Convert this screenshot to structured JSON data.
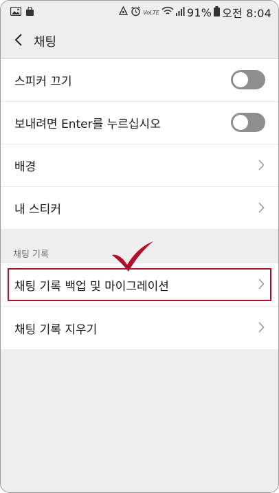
{
  "statusbar": {
    "battery": "91%",
    "time": "오전 8:04",
    "volte": "VoLTE"
  },
  "appbar": {
    "title": "채팅"
  },
  "settings": {
    "mute_sticker": {
      "label": "스피커 끄기",
      "toggle": "off"
    },
    "enter_to_send": {
      "label": "보내려면 Enter를 누르십시오",
      "toggle": "off"
    },
    "background": {
      "label": "배경"
    },
    "my_stickers": {
      "label": "내 스티커"
    }
  },
  "chat_history": {
    "section_label": "채팅 기록",
    "backup": {
      "label": "채팅 기록 백업 및 마이그레이션"
    },
    "clear": {
      "label": "채팅 기록 지우기"
    }
  },
  "colors": {
    "accent_red": "#b10f2e",
    "toggle_off": "#8e8e8e",
    "background": "#eeeeee"
  }
}
